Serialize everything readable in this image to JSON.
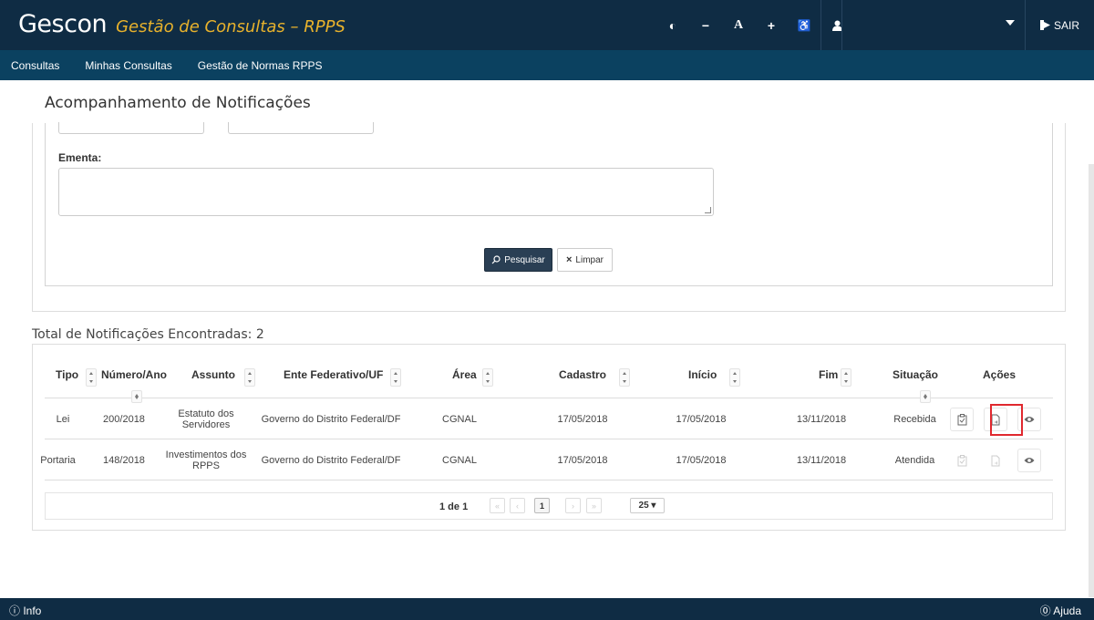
{
  "brand": {
    "name": "Gescon",
    "subtitle": "Gestão de Consultas – RPPS"
  },
  "toolbar": {
    "contrast": "◐",
    "decrease_font": "−",
    "font": "A",
    "increase_font": "+",
    "accessibility": "♿",
    "user": "👤",
    "logout": "SAIR"
  },
  "nav": [
    "Consultas",
    "Minhas Consultas",
    "Gestão de Normas RPPS"
  ],
  "page_title": "Acompanhamento de Notificações",
  "form": {
    "ementa_label": "Ementa:",
    "search_button": "Pesquisar",
    "clear_button": "Limpar"
  },
  "results": {
    "total_label": "Total de Notificações Encontradas: 2",
    "columns": [
      "Tipo",
      "Número/Ano",
      "Assunto",
      "Ente Federativo/UF",
      "Área",
      "Cadastro",
      "Início",
      "Fim",
      "Situação",
      "Ações"
    ],
    "rows": [
      {
        "tipo": "Lei",
        "numero": "200/2018",
        "assunto": "Estatuto dos Servidores",
        "ente": "Governo do Distrito Federal/DF",
        "area": "CGNAL",
        "cadastro": "17/05/2018",
        "inicio": "17/05/2018",
        "fim": "13/11/2018",
        "situacao": "Recebida"
      },
      {
        "tipo": "Portaria",
        "numero": "148/2018",
        "assunto": "Investimentos dos RPPS",
        "ente": "Governo do Distrito Federal/DF",
        "area": "CGNAL",
        "cadastro": "17/05/2018",
        "inicio": "17/05/2018",
        "fim": "13/11/2018",
        "situacao": "Atendida"
      }
    ]
  },
  "pagination": {
    "label": "1 de 1",
    "current_page": "1",
    "page_size": "25 ▾"
  },
  "footer": {
    "info": "ⓘ Info",
    "help": "⓪ Ajuda"
  },
  "colors": {
    "header": "#0f2c44",
    "nav": "#0b4160",
    "brand_accent": "#e8b22c",
    "primary_button": "#2a3f54",
    "highlight": "#e0282e"
  }
}
